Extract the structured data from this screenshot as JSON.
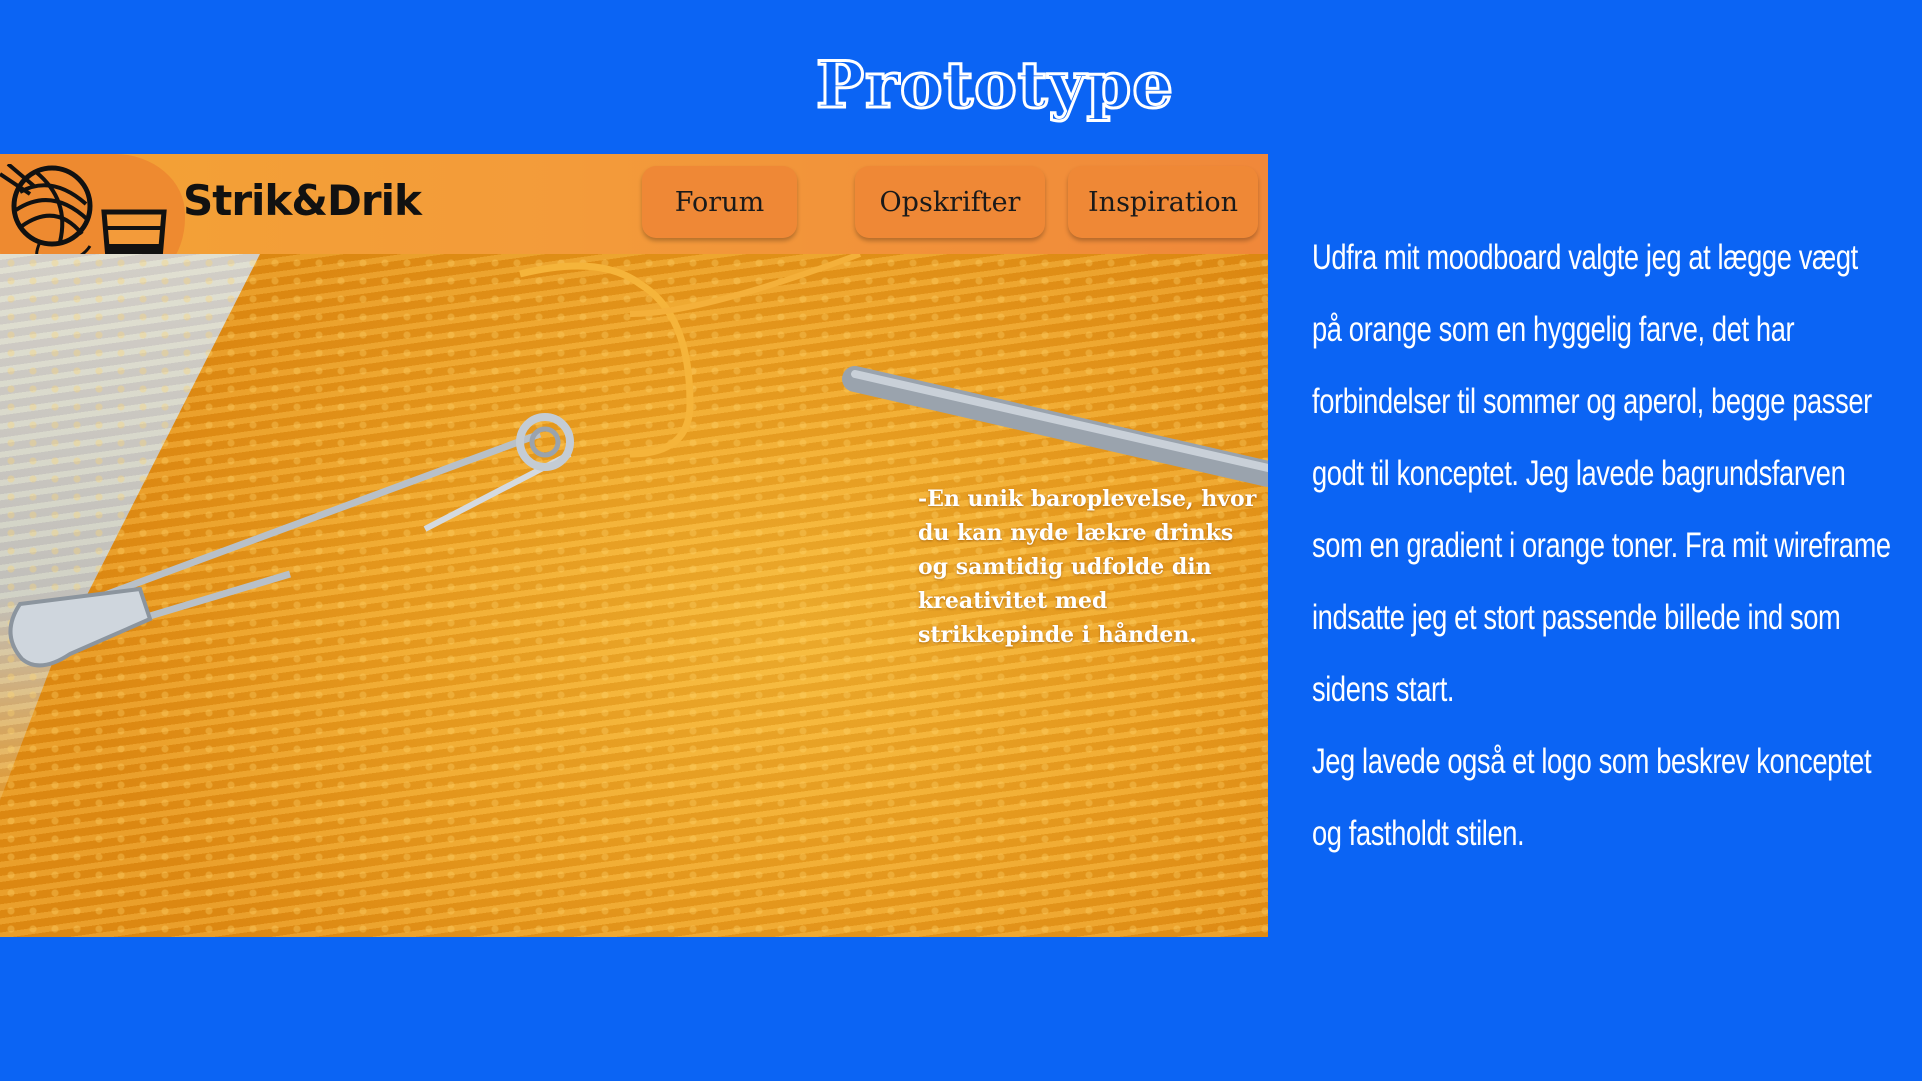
{
  "slide": {
    "title": "Prototype"
  },
  "mockup": {
    "brand": "Strik&Drik",
    "nav": [
      {
        "label": "Forum"
      },
      {
        "label": "Opskrifter"
      },
      {
        "label": "Inspiration"
      }
    ],
    "tagline": "-En unik baroplevelse, hvor du kan nyde lækre drinks og samtidig udfolde din kreativitet med strikkepinde i hånden.",
    "logo_icons": [
      "yarn-ball-icon",
      "drink-glass-icon"
    ]
  },
  "description": {
    "paragraph1": "Udfra mit moodboard valgte jeg at lægge vægt på orange som en hyggelig farve, det har forbindelser til sommer og aperol, begge passer godt til konceptet. Jeg lavede bagrundsfarven som en gradient i orange toner. Fra mit wireframe indsatte jeg et stort passende billede ind som sidens start.",
    "paragraph2": "Jeg lavede også et logo som beskrev konceptet og fastholdt stilen."
  },
  "colors": {
    "background": "#0b64f4",
    "header_orange": "#f39b3a",
    "button_orange": "#ef8836",
    "yarn": "#f0a323"
  }
}
